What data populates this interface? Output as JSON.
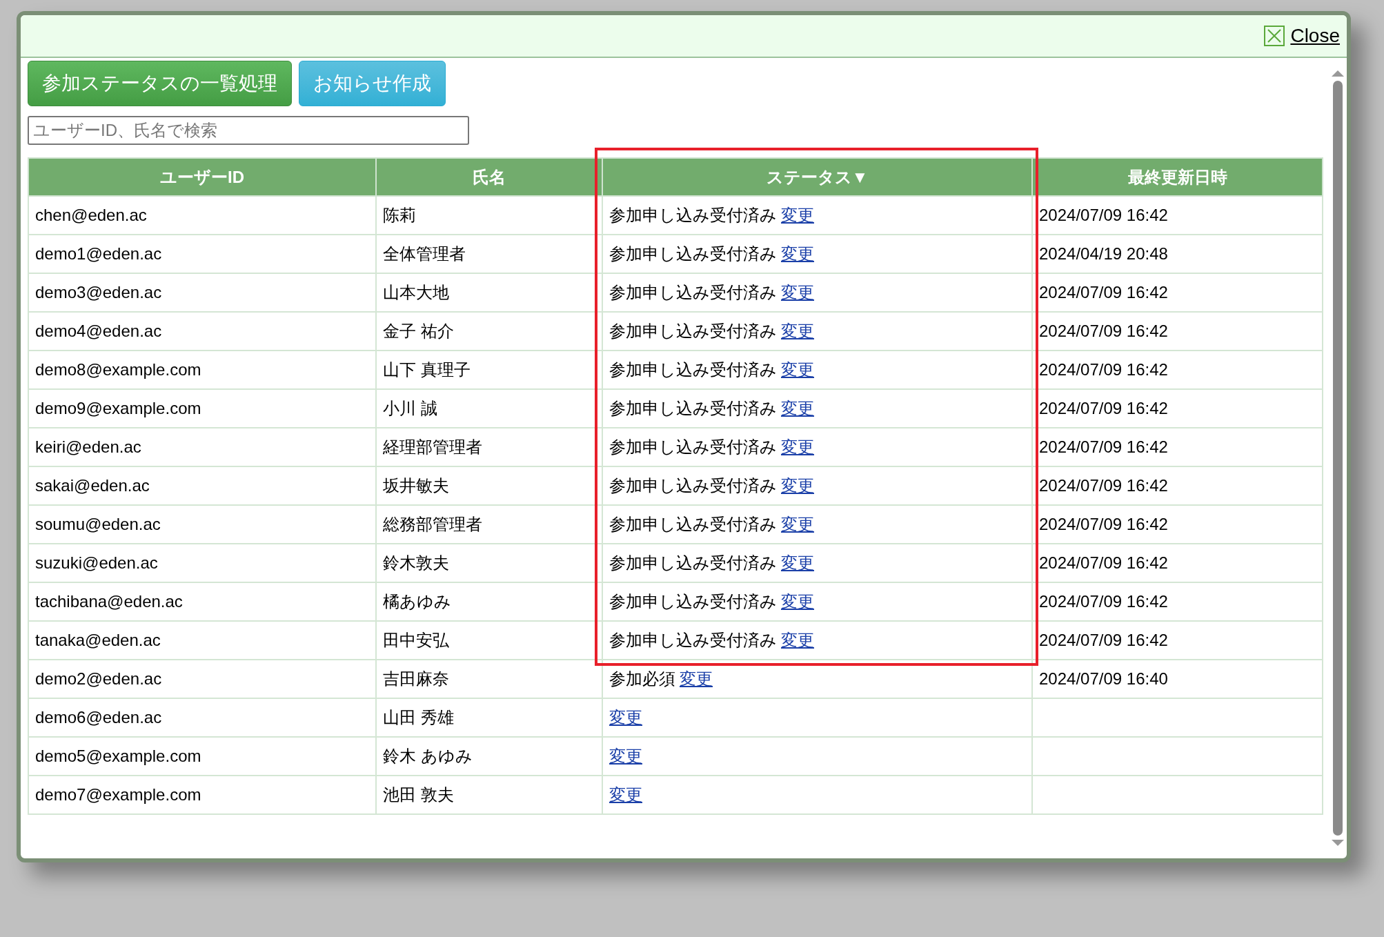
{
  "dialog": {
    "close_label": "Close"
  },
  "buttons": [
    {
      "label": "参加ステータスの一覧処理",
      "kind": "primary"
    },
    {
      "label": "お知らせ作成",
      "kind": "info"
    }
  ],
  "search": {
    "placeholder": "ユーザーID、氏名で検索"
  },
  "table": {
    "columns": [
      {
        "label": "ユーザーID",
        "highlighted": false
      },
      {
        "label": "氏名",
        "highlighted": false
      },
      {
        "label": "ステータス▼",
        "highlighted": true
      },
      {
        "label": "最終更新日時",
        "highlighted": false
      }
    ],
    "row_groups": [
      {
        "highlighted": true,
        "rows": [
          {
            "user_id": "chen@eden.ac",
            "name": "陈莉",
            "status": "参加申し込み受付済み",
            "action": "変更",
            "updated": "2024/07/09 16:42"
          },
          {
            "user_id": "demo1@eden.ac",
            "name": "全体管理者",
            "status": "参加申し込み受付済み",
            "action": "変更",
            "updated": "2024/04/19 20:48"
          },
          {
            "user_id": "demo3@eden.ac",
            "name": "山本大地",
            "status": "参加申し込み受付済み",
            "action": "変更",
            "updated": "2024/07/09 16:42"
          },
          {
            "user_id": "demo4@eden.ac",
            "name": "金子 祐介",
            "status": "参加申し込み受付済み",
            "action": "変更",
            "updated": "2024/07/09 16:42"
          },
          {
            "user_id": "demo8@example.com",
            "name": "山下 真理子",
            "status": "参加申し込み受付済み",
            "action": "変更",
            "updated": "2024/07/09 16:42"
          },
          {
            "user_id": "demo9@example.com",
            "name": "小川 誠",
            "status": "参加申し込み受付済み",
            "action": "変更",
            "updated": "2024/07/09 16:42"
          },
          {
            "user_id": "keiri@eden.ac",
            "name": "経理部管理者",
            "status": "参加申し込み受付済み",
            "action": "変更",
            "updated": "2024/07/09 16:42"
          },
          {
            "user_id": "sakai@eden.ac",
            "name": "坂井敏夫",
            "status": "参加申し込み受付済み",
            "action": "変更",
            "updated": "2024/07/09 16:42"
          },
          {
            "user_id": "soumu@eden.ac",
            "name": "総務部管理者",
            "status": "参加申し込み受付済み",
            "action": "変更",
            "updated": "2024/07/09 16:42"
          },
          {
            "user_id": "suzuki@eden.ac",
            "name": "鈴木敦夫",
            "status": "参加申し込み受付済み",
            "action": "変更",
            "updated": "2024/07/09 16:42"
          },
          {
            "user_id": "tachibana@eden.ac",
            "name": "橘あゆみ",
            "status": "参加申し込み受付済み",
            "action": "変更",
            "updated": "2024/07/09 16:42"
          },
          {
            "user_id": "tanaka@eden.ac",
            "name": "田中安弘",
            "status": "参加申し込み受付済み",
            "action": "変更",
            "updated": "2024/07/09 16:42"
          }
        ]
      },
      {
        "highlighted": false,
        "rows": [
          {
            "user_id": "demo2@eden.ac",
            "name": "吉田麻奈",
            "status": "参加必須",
            "action": "変更",
            "updated": "2024/07/09 16:40"
          },
          {
            "user_id": "demo6@eden.ac",
            "name": "山田 秀雄",
            "action": "変更"
          },
          {
            "user_id": "demo5@example.com",
            "name": "鈴木 あゆみ",
            "action": "変更"
          },
          {
            "user_id": "demo7@example.com",
            "name": "池田 敦夫",
            "action": "変更"
          }
        ]
      }
    ]
  }
}
